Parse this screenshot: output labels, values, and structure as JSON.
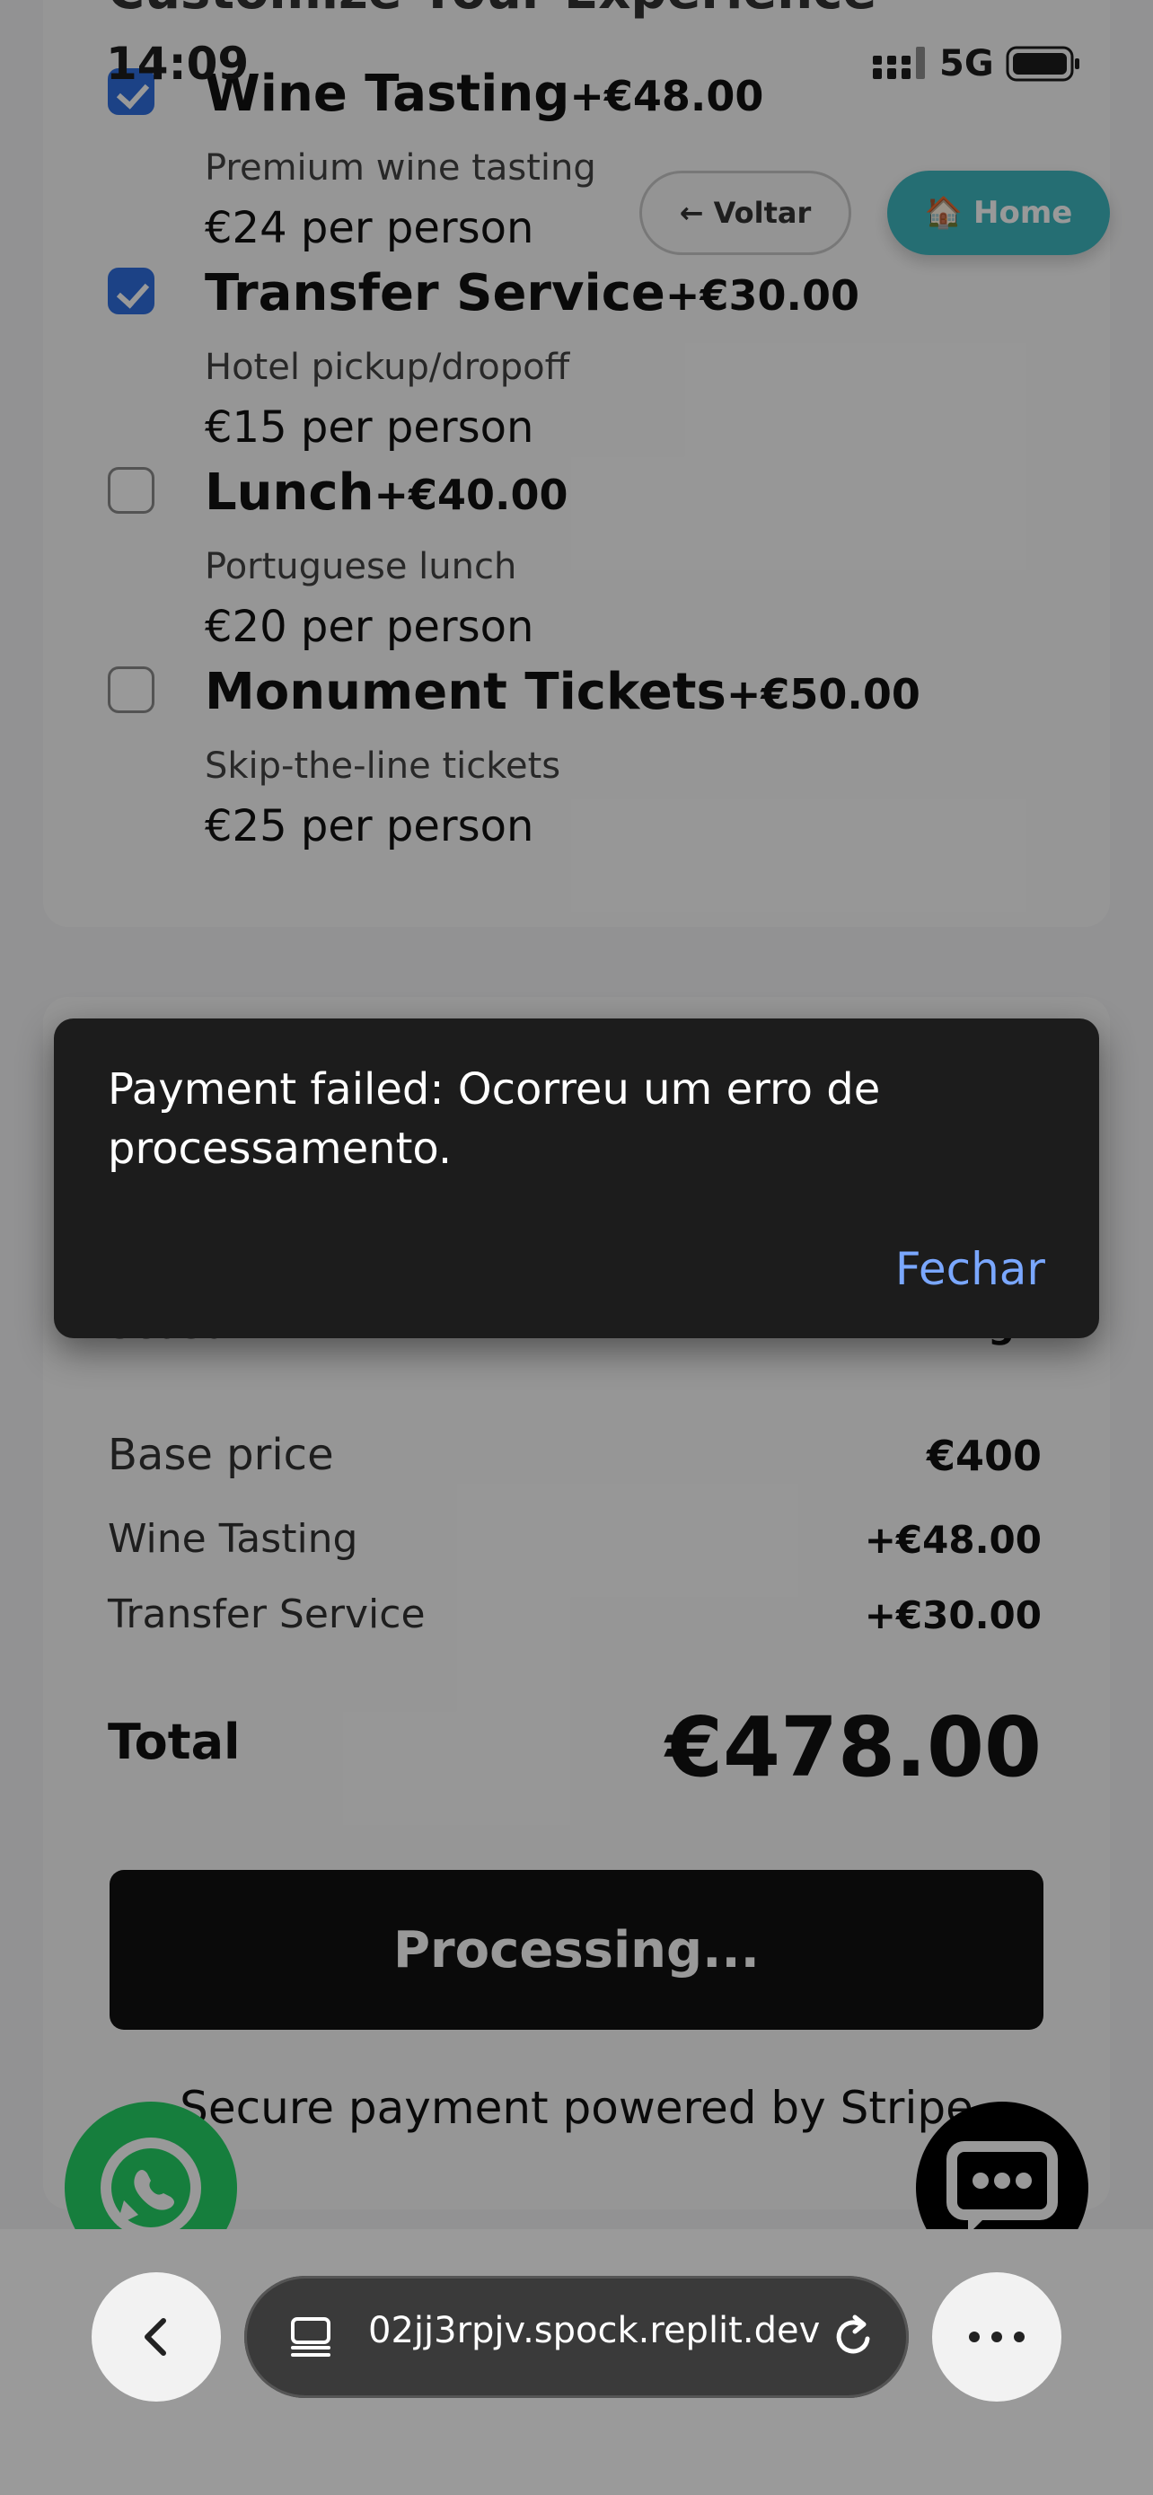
{
  "status": {
    "time": "14:09",
    "network": "5G"
  },
  "header": {
    "back_label": "← Voltar",
    "home_label": "Home",
    "home_icon": "🏠",
    "section_title_partial": "Customize Your Experience"
  },
  "addons": [
    {
      "name": "Wine Tasting",
      "price": "+€48.00",
      "description": "Premium wine tasting",
      "per_person": "€24 per person",
      "checked": true
    },
    {
      "name": "Transfer Service",
      "price": "+€30.00",
      "description": "Hotel pickup/dropoff",
      "per_person": "€15 per person",
      "checked": true
    },
    {
      "name": "Lunch",
      "price": "+€40.00",
      "description": "Portuguese lunch",
      "per_person": "€20 per person",
      "checked": false
    },
    {
      "name": "Monument Tickets",
      "price": "+€50.00",
      "description": "Skip-the-line tickets",
      "per_person": "€25 per person",
      "checked": false
    }
  ],
  "summary": {
    "season_label": "Season",
    "season_value": "High",
    "rows": [
      {
        "label": "Base price",
        "value": "€400"
      },
      {
        "label": "Wine Tasting",
        "value": "+€48.00"
      },
      {
        "label": "Transfer Service",
        "value": "+€30.00"
      }
    ],
    "total_label": "Total",
    "total_value": "€478.00"
  },
  "pay_button_label": "Processing...",
  "secure_text": "Secure payment powered by Stripe",
  "snackbar": {
    "message": "Payment failed: Ocorreu um erro de processamento.",
    "action_label": "Fechar"
  },
  "browser": {
    "url": "02jj3rpjv.spock.replit.dev"
  },
  "colors": {
    "accent_blue": "#2f6fe0",
    "home_teal": "#3fb8c0",
    "snackbar_action": "#7aa7ff",
    "whatsapp_green": "#25d366"
  }
}
